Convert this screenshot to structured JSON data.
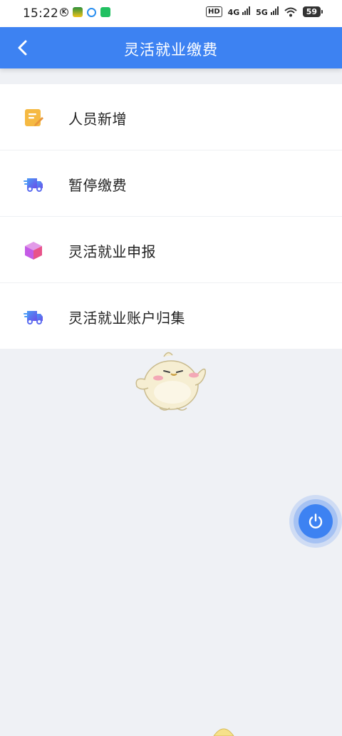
{
  "status_bar": {
    "time": "15:22",
    "network_hd": "HD",
    "network_4g": "4G",
    "network_5g": "5G",
    "battery": "59"
  },
  "header": {
    "title": "灵活就业缴费",
    "back_icon": "chevron-left-icon"
  },
  "menu": {
    "items": [
      {
        "label": "人员新增",
        "icon": "edit-note-icon",
        "color": "#f5b942"
      },
      {
        "label": "暂停缴费",
        "icon": "truck-icon",
        "color": "#5b6cf0"
      },
      {
        "label": "灵活就业申报",
        "icon": "cube-box-icon",
        "color": "#c45be6"
      },
      {
        "label": "灵活就业账户归集",
        "icon": "truck-icon",
        "color": "#5b6cf0"
      }
    ]
  },
  "floating_button": {
    "icon": "power-icon",
    "color": "#3d82f2"
  },
  "colors": {
    "accent": "#3d82f2",
    "background": "#eff1f5"
  }
}
